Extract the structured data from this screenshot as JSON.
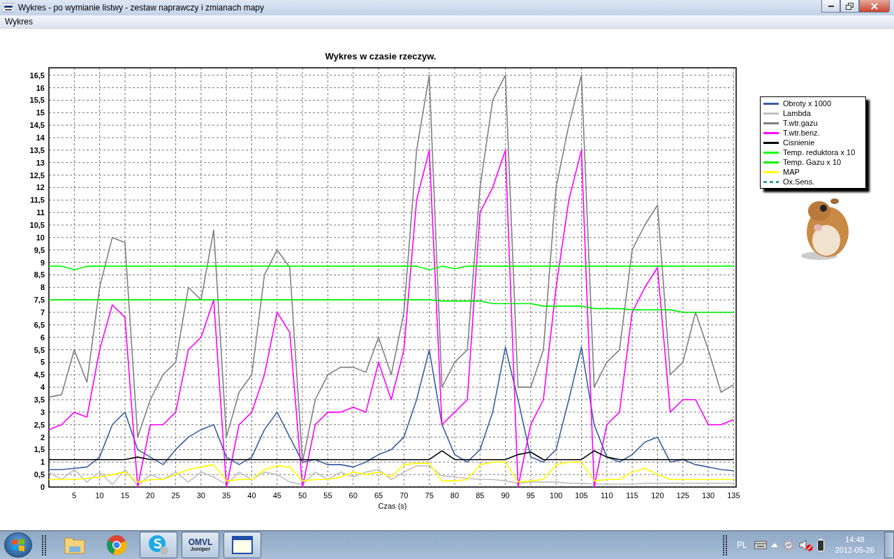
{
  "window": {
    "title": "Wykres - po wymianie listwy - zestaw naprawczy i zmianach mapy"
  },
  "menu": [
    {
      "label": "Wykres"
    }
  ],
  "chart": {
    "chart_data": {
      "type": "line",
      "title": "Wykres w czasie rzeczyw.",
      "xlabel": "Czas (s)",
      "x": [
        0,
        2.5,
        5,
        7.5,
        10,
        12.5,
        15,
        17.5,
        20,
        22.5,
        25,
        27.5,
        30,
        32.5,
        35,
        37.5,
        40,
        42.5,
        45,
        47.5,
        50,
        52.5,
        55,
        57.5,
        60,
        62.5,
        65,
        67.5,
        70,
        72.5,
        75,
        77.5,
        80,
        82.5,
        85,
        87.5,
        90,
        92.5,
        95,
        97.5,
        100,
        102.5,
        105,
        107.5,
        110,
        112.5,
        115,
        117.5,
        120,
        122.5,
        125,
        127.5,
        130,
        132.5,
        135
      ],
      "grid": true,
      "xlim": [
        0,
        135.5
      ],
      "ylim": [
        0,
        16.8
      ],
      "xticks": [
        5,
        10,
        15,
        20,
        25,
        30,
        35,
        40,
        45,
        50,
        55,
        60,
        65,
        70,
        75,
        80,
        85,
        90,
        95,
        100,
        105,
        110,
        115,
        120,
        125,
        130,
        135
      ],
      "yticks": [
        {
          "value": 0,
          "label": "0"
        },
        {
          "value": 0.5,
          "label": "0,5"
        },
        {
          "value": 1,
          "label": "1"
        },
        {
          "value": 1.5,
          "label": "1,5"
        },
        {
          "value": 2,
          "label": "2"
        },
        {
          "value": 2.5,
          "label": "2,5"
        },
        {
          "value": 3,
          "label": "3"
        },
        {
          "value": 3.5,
          "label": "3,5"
        },
        {
          "value": 4,
          "label": "4"
        },
        {
          "value": 4.5,
          "label": "4,5"
        },
        {
          "value": 5,
          "label": "5"
        },
        {
          "value": 5.5,
          "label": "5,5"
        },
        {
          "value": 6,
          "label": "6"
        },
        {
          "value": 6.5,
          "label": "6,5"
        },
        {
          "value": 7,
          "label": "7"
        },
        {
          "value": 7.5,
          "label": "7,5"
        },
        {
          "value": 8,
          "label": "8"
        },
        {
          "value": 8.5,
          "label": "8,5"
        },
        {
          "value": 9,
          "label": "9"
        },
        {
          "value": 9.5,
          "label": "9,5"
        },
        {
          "value": 10,
          "label": "10"
        },
        {
          "value": 10.5,
          "label": "10,5"
        },
        {
          "value": 11,
          "label": "11"
        },
        {
          "value": 11.5,
          "label": "11,5"
        },
        {
          "value": 12,
          "label": "12"
        },
        {
          "value": 12.5,
          "label": "12,5"
        },
        {
          "value": 13,
          "label": "13"
        },
        {
          "value": 13.5,
          "label": "13,5"
        },
        {
          "value": 14,
          "label": "14"
        },
        {
          "value": 14.5,
          "label": "14,5"
        },
        {
          "value": 15,
          "label": "15"
        },
        {
          "value": 15.5,
          "label": "15,5"
        },
        {
          "value": 16,
          "label": "16"
        },
        {
          "value": 16.5,
          "label": "16,5"
        }
      ],
      "series": [
        {
          "name": "Obroty x 1000",
          "color": "#3a5fa0",
          "values": [
            0.7,
            0.7,
            0.75,
            0.8,
            1.2,
            2.5,
            3,
            1.5,
            1.2,
            0.9,
            1.5,
            2,
            2.3,
            2.5,
            1.2,
            0.9,
            1.2,
            2.3,
            3,
            2,
            1,
            1.1,
            0.9,
            0.9,
            0.8,
            1,
            1.3,
            1.5,
            2,
            3.5,
            5.5,
            2.5,
            1.3,
            1,
            1.5,
            3,
            5.6,
            3.5,
            1.2,
            1,
            1.5,
            3.5,
            5.6,
            2.5,
            1.2,
            1,
            1.3,
            1.8,
            2,
            1,
            1.1,
            0.9,
            0.8,
            0.7,
            0.65
          ]
        },
        {
          "name": "Lambda",
          "color": "#c0c0c0",
          "values": [
            0.6,
            0.3,
            0.7,
            0.2,
            0.6,
            0.1,
            0.7,
            0.05,
            0.5,
            0.3,
            0.6,
            0.2,
            0.6,
            0.4,
            0.1,
            0.6,
            0.3,
            0.6,
            0.5,
            0.2,
            0.1,
            0.6,
            0.3,
            0.6,
            0.4,
            0.6,
            0.7,
            0.3,
            0.6,
            0.85,
            0.85,
            0.45,
            0.4,
            0.35,
            0.3,
            0.3,
            0.25,
            0.15,
            0.2,
            0.2,
            0.2,
            0.15,
            0.15,
            0.12,
            0.12,
            0.12,
            0.12,
            0.15,
            0.15,
            0.15,
            0.15,
            0.15,
            0.15,
            0.15,
            0.15
          ]
        },
        {
          "name": "T.wtr.gazu",
          "color": "#808080",
          "values": [
            3.6,
            3.7,
            5.5,
            4.2,
            8,
            10,
            9.8,
            2,
            3.5,
            4.5,
            5,
            8,
            7.5,
            10.3,
            2,
            3.8,
            4.5,
            8.5,
            9.5,
            8.8,
            1,
            3.5,
            4.5,
            4.8,
            4.8,
            4.6,
            6,
            4.5,
            7,
            13.5,
            16.5,
            4,
            5,
            5.5,
            12,
            15.5,
            16.5,
            4,
            4,
            5.5,
            12,
            14.5,
            16.5,
            4,
            5,
            5.5,
            9.5,
            10.5,
            11.3,
            4.5,
            5,
            7,
            5.5,
            3.8,
            4.1
          ]
        },
        {
          "name": "T.wtr.benz.",
          "color": "#ff00ff",
          "values": [
            2.3,
            2.5,
            3,
            2.8,
            5.5,
            7.3,
            6.8,
            0,
            2.5,
            2.5,
            3,
            5.5,
            6,
            7.5,
            0,
            2.5,
            3,
            4.5,
            7,
            6.2,
            0,
            2.5,
            3,
            3,
            3.2,
            3,
            5,
            3.5,
            5.5,
            11.5,
            13.5,
            2.5,
            3,
            3.5,
            11,
            12,
            13.5,
            0,
            2.5,
            3.5,
            8,
            11.5,
            13.5,
            0,
            2.5,
            3,
            7,
            8,
            8.8,
            3,
            3.5,
            3.5,
            2.5,
            2.5,
            2.7
          ]
        },
        {
          "name": "Cisnienie",
          "color": "#000000",
          "values": [
            1.1,
            1.1,
            1.1,
            1.1,
            1.1,
            1.1,
            1.1,
            1.2,
            1.1,
            1.1,
            1.1,
            1.1,
            1.1,
            1.1,
            1.1,
            1.1,
            1.1,
            1.1,
            1.1,
            1.1,
            1.1,
            1.1,
            1.1,
            1.1,
            1.1,
            1.1,
            1.1,
            1.1,
            1.1,
            1.1,
            1.1,
            1.45,
            1.1,
            1.1,
            1.1,
            1.1,
            1.1,
            1.3,
            1.4,
            1.1,
            1.1,
            1.1,
            1.1,
            1.45,
            1.2,
            1.1,
            1.1,
            1.1,
            1.1,
            1.1,
            1.1,
            1.1,
            1.1,
            1.1,
            1.1
          ]
        },
        {
          "name": "Temp. reduktora x 10",
          "color": "#00ff00",
          "values": [
            8.85,
            8.85,
            8.7,
            8.85,
            8.85,
            8.85,
            8.85,
            8.85,
            8.85,
            8.85,
            8.85,
            8.85,
            8.85,
            8.85,
            8.85,
            8.85,
            8.85,
            8.85,
            8.85,
            8.85,
            8.85,
            8.85,
            8.85,
            8.85,
            8.85,
            8.85,
            8.85,
            8.85,
            8.85,
            8.85,
            8.7,
            8.85,
            8.75,
            8.85,
            8.85,
            8.85,
            8.85,
            8.85,
            8.85,
            8.85,
            8.85,
            8.85,
            8.85,
            8.85,
            8.85,
            8.85,
            8.85,
            8.85,
            8.85,
            8.85,
            8.85,
            8.85,
            8.85,
            8.85,
            8.85
          ]
        },
        {
          "name": "Temp. Gazu x 10",
          "color": "#00ee00",
          "values": [
            7.5,
            7.5,
            7.5,
            7.5,
            7.5,
            7.5,
            7.5,
            7.5,
            7.5,
            7.5,
            7.5,
            7.5,
            7.5,
            7.5,
            7.5,
            7.5,
            7.5,
            7.5,
            7.5,
            7.5,
            7.5,
            7.5,
            7.5,
            7.5,
            7.5,
            7.5,
            7.5,
            7.5,
            7.5,
            7.5,
            7.5,
            7.45,
            7.45,
            7.45,
            7.45,
            7.35,
            7.35,
            7.35,
            7.35,
            7.25,
            7.25,
            7.25,
            7.25,
            7.15,
            7.15,
            7.15,
            7.1,
            7.1,
            7.1,
            7.1,
            7,
            7,
            7,
            7,
            7
          ]
        },
        {
          "name": "MAP",
          "color": "#ffff00",
          "values": [
            0.3,
            0.3,
            0.3,
            0.35,
            0.4,
            0.5,
            0.6,
            0.2,
            0.3,
            0.3,
            0.5,
            0.7,
            0.8,
            0.9,
            0.25,
            0.3,
            0.3,
            0.7,
            0.85,
            0.8,
            0.25,
            0.3,
            0.3,
            0.4,
            0.6,
            0.5,
            0.6,
            0.4,
            0.9,
            0.95,
            0.95,
            0.25,
            0.25,
            0.3,
            0.9,
            1,
            1,
            0.2,
            0.25,
            0.3,
            0.9,
            1,
            1,
            0.25,
            0.3,
            0.3,
            0.6,
            0.75,
            0.5,
            0.3,
            0.3,
            0.3,
            0.3,
            0.3,
            0.3
          ]
        },
        {
          "name": "Ox.Sens.",
          "color": "#3a9aa8",
          "values": [
            null,
            null,
            null,
            null,
            null,
            null,
            null,
            null,
            null,
            null,
            null,
            null,
            null,
            null,
            null,
            null,
            null,
            null,
            null,
            null,
            null,
            null,
            null,
            null,
            null,
            null,
            null,
            null,
            null,
            null,
            null,
            null,
            null,
            null,
            null,
            null,
            null,
            null,
            null,
            null,
            null,
            null,
            null,
            null,
            null,
            null,
            null,
            null,
            null,
            null,
            null,
            null,
            null,
            null,
            null
          ]
        }
      ]
    }
  },
  "legend": [
    {
      "kind": "solid"
    },
    {
      "kind": "solid"
    },
    {
      "kind": "solid"
    },
    {
      "kind": "solid"
    },
    {
      "kind": "solid"
    },
    {
      "kind": "solid"
    },
    {
      "kind": "solid"
    },
    {
      "kind": "solid"
    },
    {
      "kind": "dashed"
    }
  ],
  "taskbar": {
    "apps": [
      {
        "kind": "folder",
        "running": false
      },
      {
        "kind": "chrome",
        "running": false
      },
      {
        "kind": "skype",
        "running": true
      },
      {
        "kind": "omvl",
        "running": true,
        "label": "OMVL",
        "sublabel": "Juniper"
      },
      {
        "kind": "window",
        "running": true
      }
    ],
    "tray": {
      "language": "PL",
      "speaker_muted": true,
      "time": "14:48",
      "date": "2012-05-26"
    }
  }
}
